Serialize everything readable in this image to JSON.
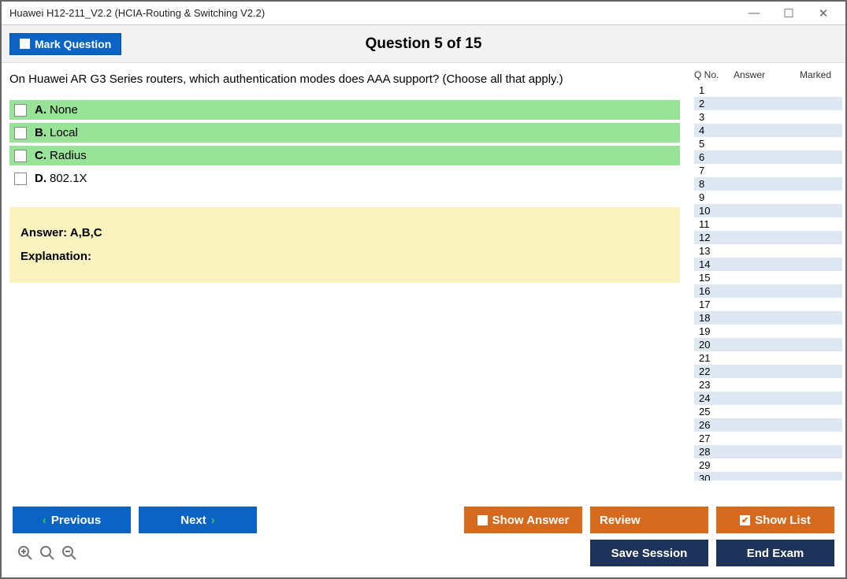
{
  "window": {
    "title": "Huawei H12-211_V2.2 (HCIA-Routing & Switching V2.2)"
  },
  "top": {
    "mark_label": "Mark Question",
    "header": "Question 5 of 15"
  },
  "question": {
    "prompt": "On Huawei AR G3 Series routers, which authentication modes does AAA support? (Choose all that apply.)",
    "options": [
      {
        "letter": "A.",
        "text": "None",
        "correct": true
      },
      {
        "letter": "B.",
        "text": "Local",
        "correct": true
      },
      {
        "letter": "C.",
        "text": "Radius",
        "correct": true
      },
      {
        "letter": "D.",
        "text": "802.1X",
        "correct": false
      }
    ],
    "answer_label": "Answer: A,B,C",
    "explanation_label": "Explanation:"
  },
  "side": {
    "headers": {
      "qno": "Q No.",
      "answer": "Answer",
      "marked": "Marked"
    },
    "rows": 30
  },
  "buttons": {
    "previous": "Previous",
    "next": "Next",
    "show_answer": "Show Answer",
    "review": "Review",
    "show_list": "Show List",
    "save_session": "Save Session",
    "end_exam": "End Exam"
  }
}
